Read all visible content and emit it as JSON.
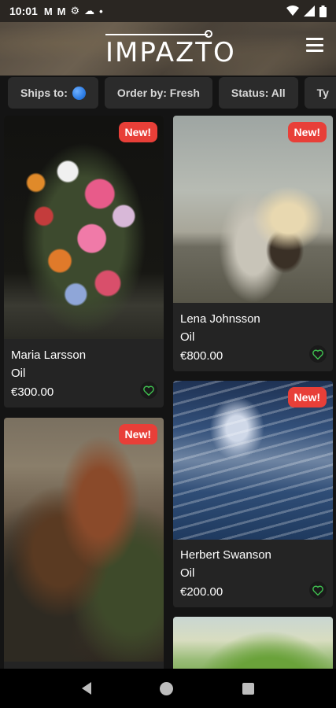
{
  "status_bar": {
    "time": "10:01",
    "left_icons": [
      "gmail-icon",
      "gmail-icon",
      "settings-icon",
      "cloud-icon",
      "dot-icon"
    ],
    "right_icons": [
      "wifi-icon",
      "signal-icon",
      "battery-icon"
    ]
  },
  "header": {
    "logo_text": "IMPAZTO",
    "menu_icon": "hamburger-menu-icon"
  },
  "filters": [
    {
      "label": "Ships to:",
      "icon": "globe-icon"
    },
    {
      "label": "Order by: Fresh"
    },
    {
      "label": "Status: All"
    },
    {
      "label": "Ty"
    }
  ],
  "cards": [
    {
      "artist": "Maria Larsson",
      "medium": "Oil",
      "price": "€300.00",
      "badge": "New!",
      "art": "flower-still-life"
    },
    {
      "artist": "Lena Johnsson",
      "medium": "Oil",
      "price": "€800.00",
      "badge": "New!",
      "art": "sailing-ship"
    },
    {
      "artist": "",
      "medium": "",
      "price": "",
      "badge": "New!",
      "art": "forest-landscape"
    },
    {
      "artist": "Herbert Swanson",
      "medium": "Oil",
      "price": "€200.00",
      "badge": "New!",
      "art": "stormy-sea"
    },
    {
      "artist": "",
      "medium": "",
      "price": "",
      "badge": "",
      "art": "green-hills"
    }
  ],
  "colors": {
    "badge": "#e83f38",
    "heart": "#3fbf4f",
    "chip_bg": "#2b2b2b",
    "card_bg": "#242424"
  }
}
